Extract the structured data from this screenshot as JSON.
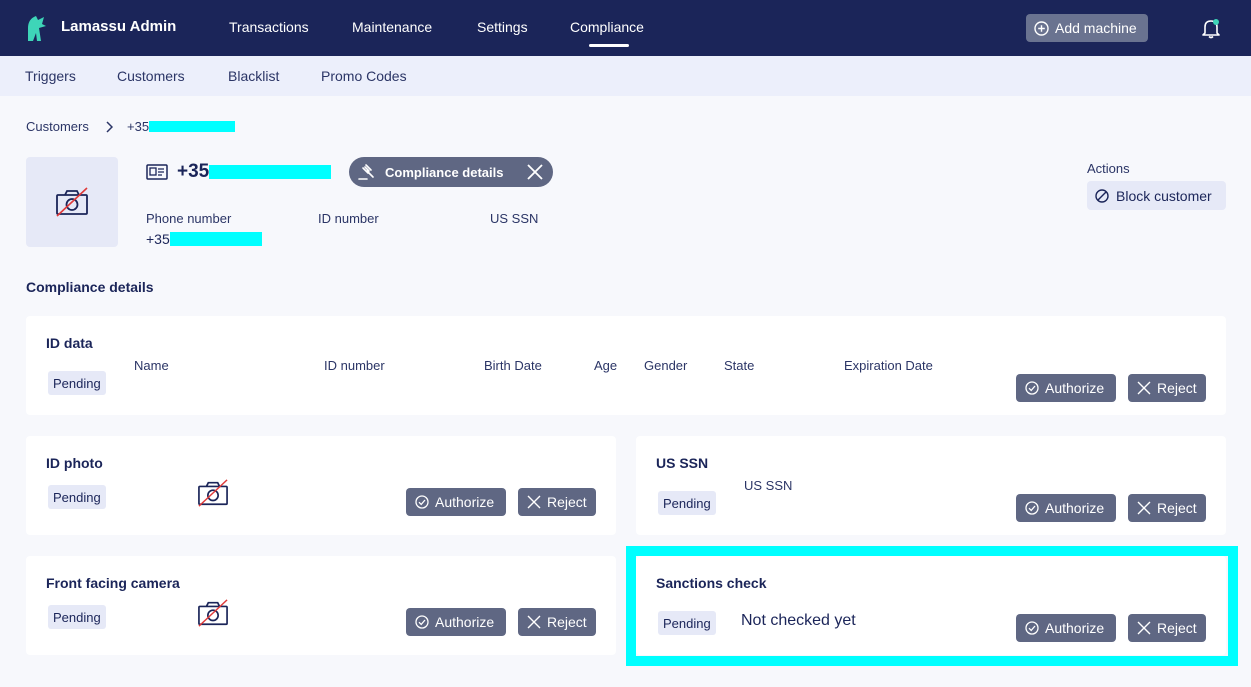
{
  "topbar": {
    "brand": "Lamassu Admin",
    "nav": [
      "Transactions",
      "Maintenance",
      "Settings",
      "Compliance"
    ],
    "active_nav": "Compliance",
    "add_machine": "Add machine"
  },
  "subnav": [
    "Triggers",
    "Customers",
    "Blacklist",
    "Promo Codes"
  ],
  "breadcrumb": {
    "parent": "Customers",
    "current": "+35"
  },
  "customer": {
    "phone_prefix": "+35",
    "chip_label": "Compliance details",
    "fields": {
      "phone_label": "Phone number",
      "phone_value": "+35",
      "id_label": "ID number",
      "ssn_label": "US SSN"
    }
  },
  "actions": {
    "label": "Actions",
    "block": "Block customer"
  },
  "section_title": "Compliance details",
  "cards": {
    "id_data": {
      "title": "ID data",
      "status": "Pending",
      "columns": [
        "Name",
        "ID number",
        "Birth Date",
        "Age",
        "Gender",
        "State",
        "Expiration Date"
      ]
    },
    "id_photo": {
      "title": "ID photo",
      "status": "Pending"
    },
    "us_ssn": {
      "title": "US SSN",
      "status": "Pending",
      "column": "US SSN"
    },
    "front_camera": {
      "title": "Front facing camera",
      "status": "Pending"
    },
    "sanctions": {
      "title": "Sanctions check",
      "status": "Pending",
      "value": "Not checked yet"
    }
  },
  "buttons": {
    "authorize": "Authorize",
    "reject": "Reject"
  },
  "colors": {
    "navy": "#1b2559",
    "button": "#5f6783",
    "highlight": "#00ffff",
    "subnav": "#eceffb"
  },
  "icons": [
    "logo-icon",
    "add-circle-icon",
    "bell-icon",
    "camera-off-icon",
    "id-card-icon",
    "gavel-icon",
    "close-icon",
    "block-icon",
    "check-circle-icon",
    "x-icon",
    "chevron-right-icon"
  ]
}
